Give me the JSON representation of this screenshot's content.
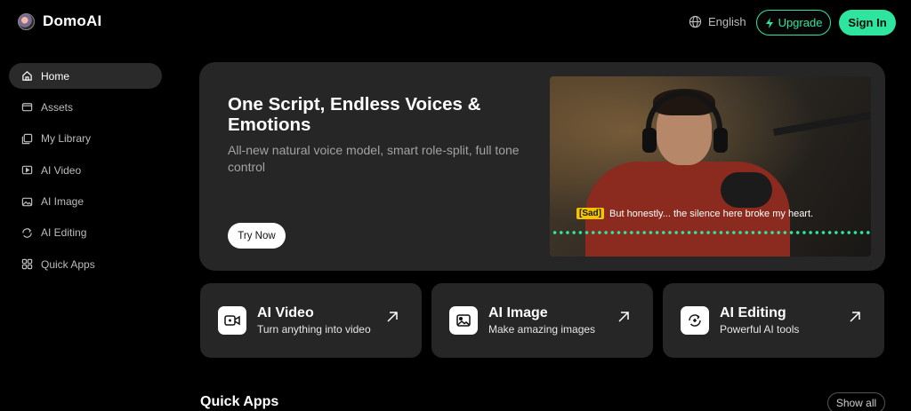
{
  "header": {
    "brand": "DomoAI",
    "language": "English",
    "upgrade_label": "Upgrade",
    "signin_label": "Sign In"
  },
  "sidebar": {
    "items": [
      {
        "label": "Home",
        "icon": "home-icon",
        "active": true
      },
      {
        "label": "Assets",
        "icon": "assets-icon"
      },
      {
        "label": "My Library",
        "icon": "library-icon"
      },
      {
        "label": "AI Video",
        "icon": "video-icon"
      },
      {
        "label": "AI Image",
        "icon": "image-icon"
      },
      {
        "label": "AI Editing",
        "icon": "editing-icon"
      },
      {
        "label": "Quick Apps",
        "icon": "apps-icon"
      }
    ]
  },
  "hero": {
    "title": "One Script, Endless Voices & Emotions",
    "subtitle": "All-new natural voice model, smart role-split, full tone control",
    "cta": "Try Now",
    "caption_tag": "[Sad]",
    "caption_text": "But honestly... the silence here broke my heart."
  },
  "cards": [
    {
      "title": "AI Video",
      "subtitle": "Turn anything into video",
      "icon": "video-camera-icon"
    },
    {
      "title": "AI Image",
      "subtitle": "Make amazing images",
      "icon": "picture-icon"
    },
    {
      "title": "AI Editing",
      "subtitle": "Powerful AI tools",
      "icon": "magic-edit-icon"
    }
  ],
  "quick_apps": {
    "title": "Quick Apps",
    "show_all": "Show all"
  },
  "colors": {
    "accent": "#2ee59d",
    "background": "#000000",
    "panel": "#262626",
    "caption_tag": "#f5c400"
  }
}
